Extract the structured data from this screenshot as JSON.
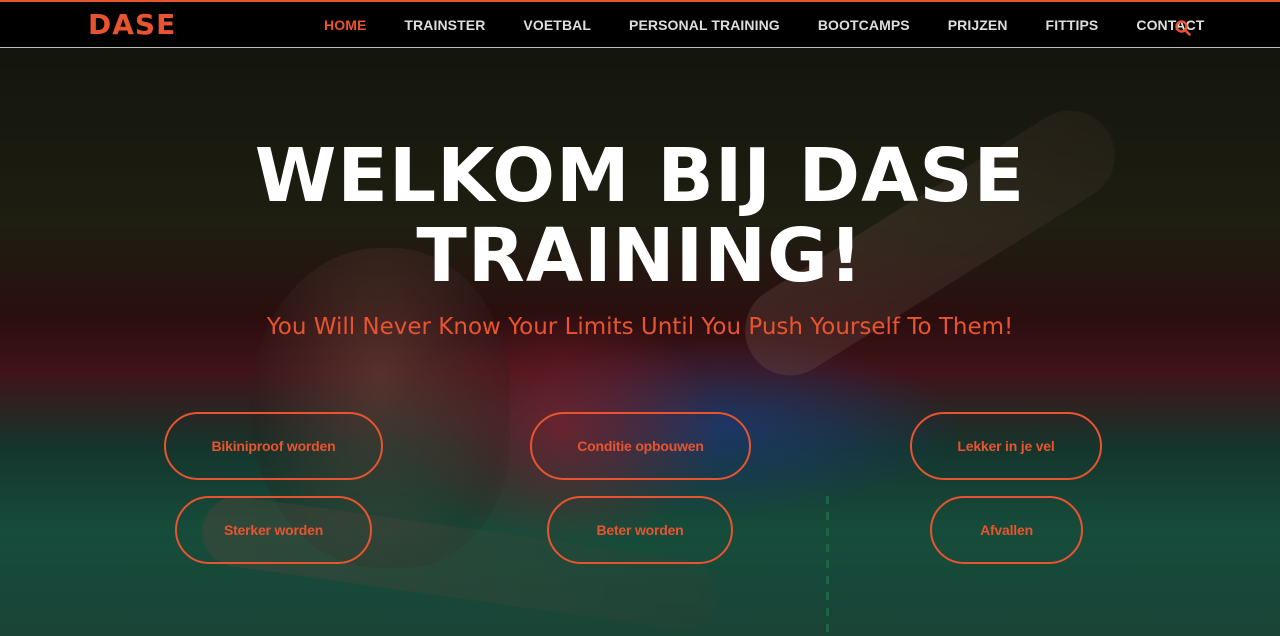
{
  "brand": {
    "logo_text": "DASE",
    "accent_color": "#e8542f"
  },
  "nav": {
    "items": [
      {
        "label": "HOME",
        "active": true
      },
      {
        "label": "TRAINSTER",
        "active": false
      },
      {
        "label": "VOETBAL",
        "active": false
      },
      {
        "label": "PERSONAL TRAINING",
        "active": false
      },
      {
        "label": "BOOTCAMPS",
        "active": false
      },
      {
        "label": "PRIJZEN",
        "active": false
      },
      {
        "label": "FITTIPS",
        "active": false
      },
      {
        "label": "CONTACT",
        "active": false
      }
    ],
    "search_icon": "search-icon"
  },
  "hero": {
    "title_line1": "WELKOM BIJ DASE",
    "title_line2": "TRAINING!",
    "subtitle": "You Will Never Know Your Limits Until You Push Yourself To Them!",
    "buttons": [
      {
        "label": "Bikiniproof worden"
      },
      {
        "label": "Conditie opbouwen"
      },
      {
        "label": "Lekker in je vel"
      },
      {
        "label": "Sterker worden"
      },
      {
        "label": "Beter worden"
      },
      {
        "label": "Afvallen"
      }
    ]
  }
}
